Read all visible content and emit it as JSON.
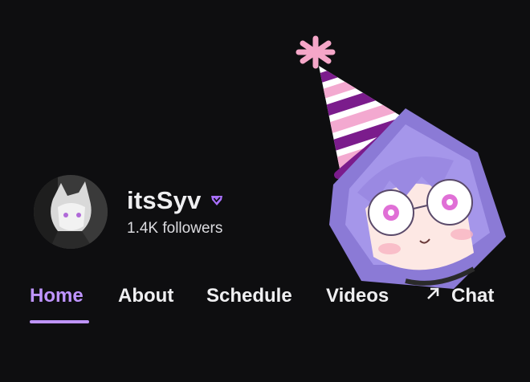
{
  "channel": {
    "name": "itsSyv",
    "followers": "1.4K followers"
  },
  "tabs": [
    {
      "label": "Home",
      "active": true
    },
    {
      "label": "About",
      "active": false
    },
    {
      "label": "Schedule",
      "active": false
    },
    {
      "label": "Videos",
      "active": false
    },
    {
      "label": "Chat",
      "active": false,
      "icon": "external-arrow-icon"
    }
  ],
  "icons": {
    "verified": "verified-badge-icon",
    "chat": "external-arrow-icon"
  },
  "colors": {
    "background": "#0e0e10",
    "accent": "#bf94ff",
    "text": "#efeff1"
  }
}
